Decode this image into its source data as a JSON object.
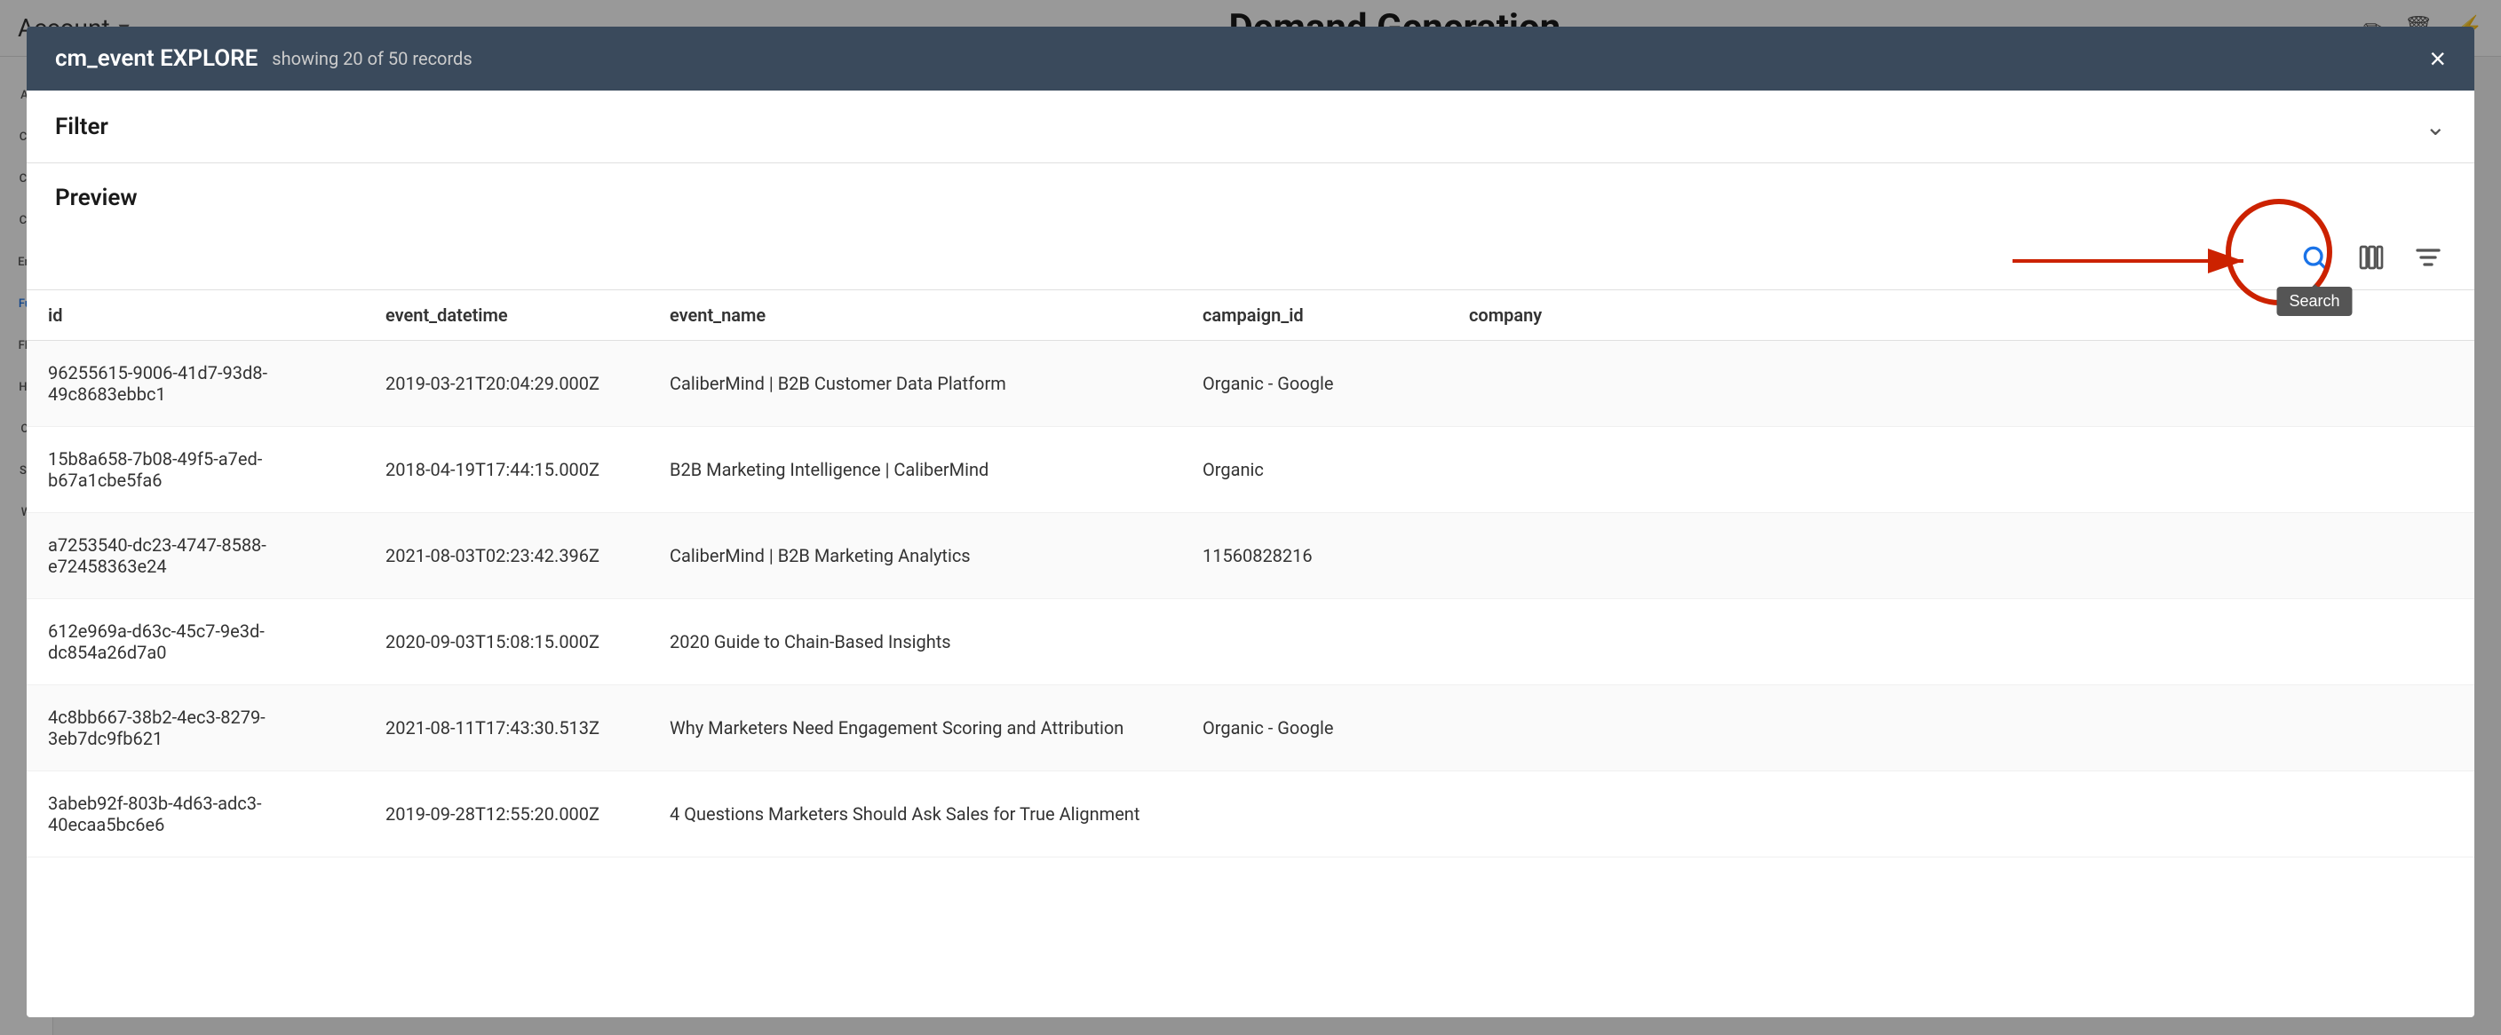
{
  "header": {
    "account_label": "Account",
    "account_chevron": "▾",
    "page_title": "Demand Generation",
    "icons": [
      "✏",
      "🗑",
      "🔗"
    ]
  },
  "sidebar": {
    "items": [
      "At",
      "Ca",
      "Ch",
      "Co",
      "Em",
      "Fu",
      "Flo",
      "Ho",
      "Ol",
      "SF",
      "W"
    ]
  },
  "modal": {
    "title": "cm_event EXPLORE",
    "subtitle": "showing 20 of 50 records",
    "close_label": "×",
    "filter_label": "Filter",
    "filter_chevron": "⌄",
    "preview_label": "Preview",
    "toolbar": {
      "search_icon": "🔍",
      "search_tooltip": "Search",
      "columns_icon": "⊞",
      "filter_icon": "≡"
    },
    "table": {
      "columns": [
        "id",
        "event_datetime",
        "event_name",
        "campaign_id",
        "company"
      ],
      "rows": [
        {
          "id": "96255615-9006-41d7-93d8-49c8683ebbc1",
          "event_datetime": "2019-03-21T20:04:29.000Z",
          "event_name": "CaliberMind | B2B Customer Data Platform",
          "campaign_id": "Organic - Google",
          "company": ""
        },
        {
          "id": "15b8a658-7b08-49f5-a7ed-b67a1cbe5fa6",
          "event_datetime": "2018-04-19T17:44:15.000Z",
          "event_name": "B2B Marketing Intelligence | CaliberMind",
          "campaign_id": "Organic",
          "company": ""
        },
        {
          "id": "a7253540-dc23-4747-8588-e72458363e24",
          "event_datetime": "2021-08-03T02:23:42.396Z",
          "event_name": "CaliberMind | B2B Marketing Analytics",
          "campaign_id": "11560828216",
          "company": ""
        },
        {
          "id": "612e969a-d63c-45c7-9e3d-dc854a26d7a0",
          "event_datetime": "2020-09-03T15:08:15.000Z",
          "event_name": "2020 Guide to Chain-Based Insights",
          "campaign_id": "",
          "company": ""
        },
        {
          "id": "4c8bb667-38b2-4ec3-8279-3eb7dc9fb621",
          "event_datetime": "2021-08-11T17:43:30.513Z",
          "event_name": "Why Marketers Need Engagement Scoring and Attribution",
          "campaign_id": "Organic - Google",
          "company": ""
        },
        {
          "id": "3abeb92f-803b-4d63-adc3-40ecaa5bc6e6",
          "event_datetime": "2019-09-28T12:55:20.000Z",
          "event_name": "4 Questions Marketers Should Ask Sales for True Alignment",
          "campaign_id": "",
          "company": ""
        }
      ]
    }
  }
}
